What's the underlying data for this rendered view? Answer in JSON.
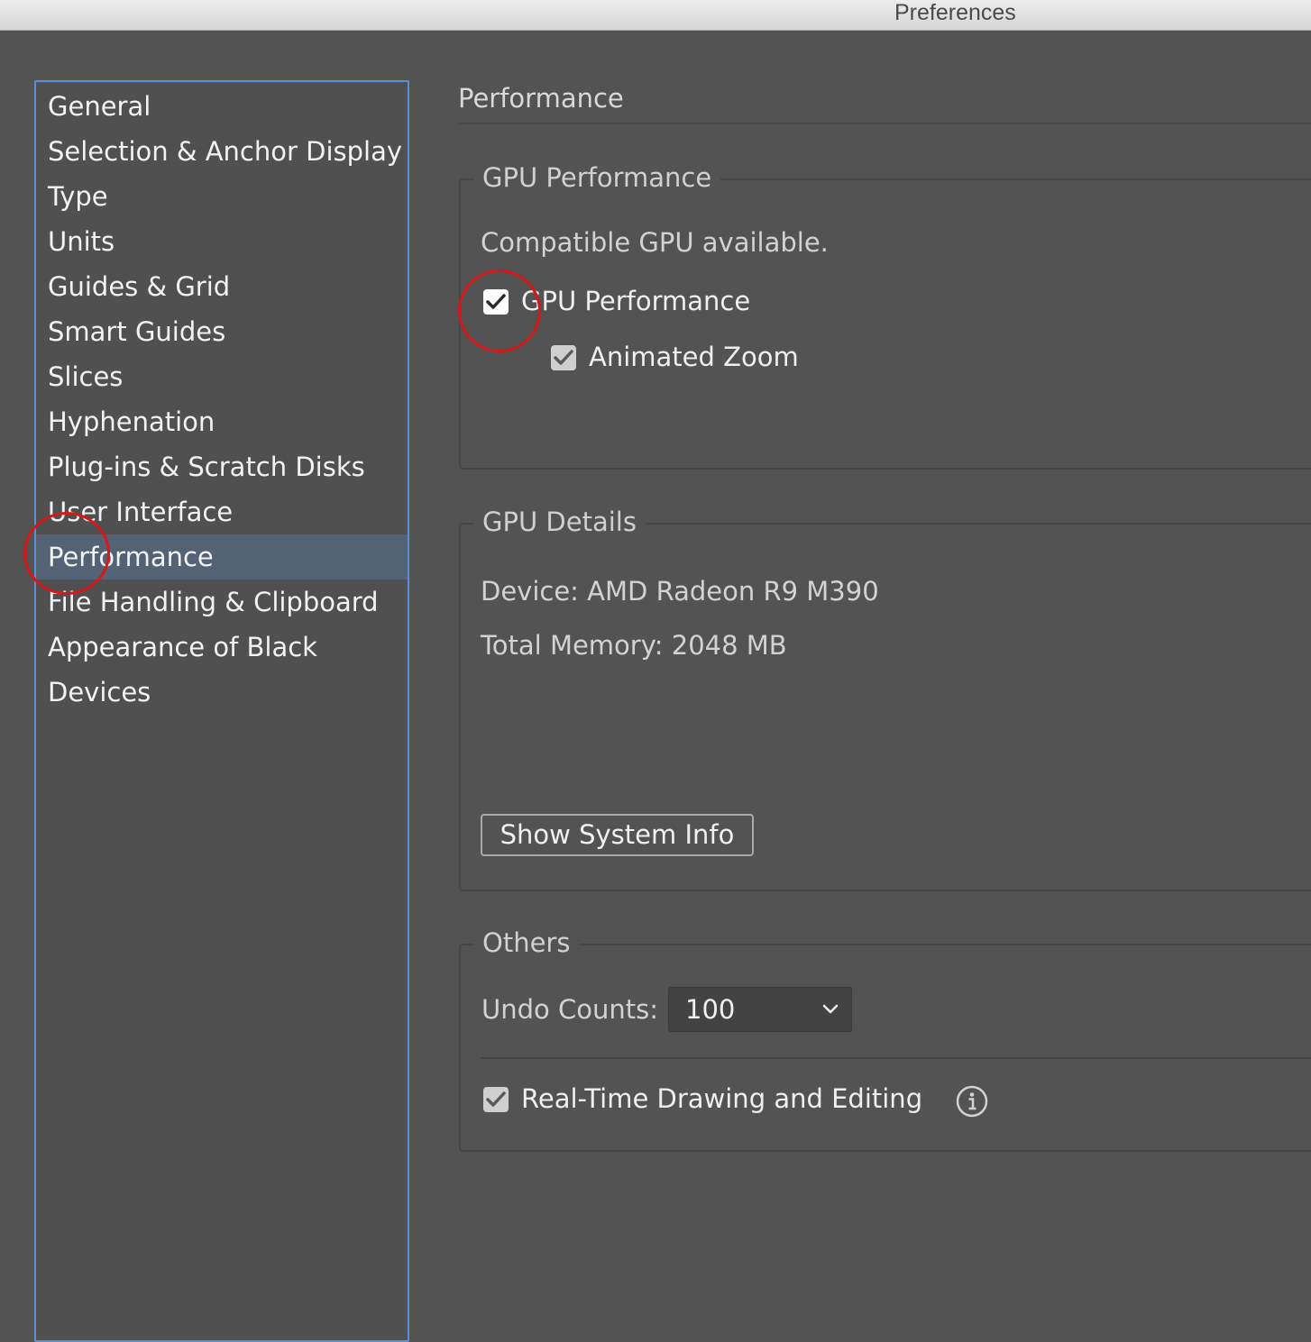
{
  "window": {
    "title": "Preferences"
  },
  "sidebar": {
    "items": [
      {
        "label": "General"
      },
      {
        "label": "Selection & Anchor Display"
      },
      {
        "label": "Type"
      },
      {
        "label": "Units"
      },
      {
        "label": "Guides & Grid"
      },
      {
        "label": "Smart Guides"
      },
      {
        "label": "Slices"
      },
      {
        "label": "Hyphenation"
      },
      {
        "label": "Plug-ins & Scratch Disks"
      },
      {
        "label": "User Interface"
      },
      {
        "label": "Performance",
        "selected": true
      },
      {
        "label": "File Handling & Clipboard"
      },
      {
        "label": "Appearance of Black"
      },
      {
        "label": "Devices"
      }
    ]
  },
  "main": {
    "title": "Performance",
    "gpu_performance": {
      "legend": "GPU Performance",
      "status": "Compatible GPU available.",
      "gpu_checkbox": {
        "label": "GPU Performance",
        "checked": true
      },
      "animated_zoom": {
        "label": "Animated Zoom",
        "checked": true
      }
    },
    "gpu_details": {
      "legend": "GPU Details",
      "device": "Device: AMD Radeon R9 M390",
      "memory": "Total Memory: 2048 MB",
      "show_system_info": "Show System Info"
    },
    "others": {
      "legend": "Others",
      "undo_label": "Undo Counts:",
      "undo_value": "100",
      "realtime": {
        "label": "Real-Time Drawing and Editing",
        "checked": true
      }
    }
  },
  "annotations": {
    "highlight_color": "#d61818"
  },
  "colors": {
    "selection": "#546275",
    "focus_border": "#5b8fd6"
  },
  "icons": [
    "checkmark-icon",
    "chevron-down-icon",
    "info-icon"
  ]
}
